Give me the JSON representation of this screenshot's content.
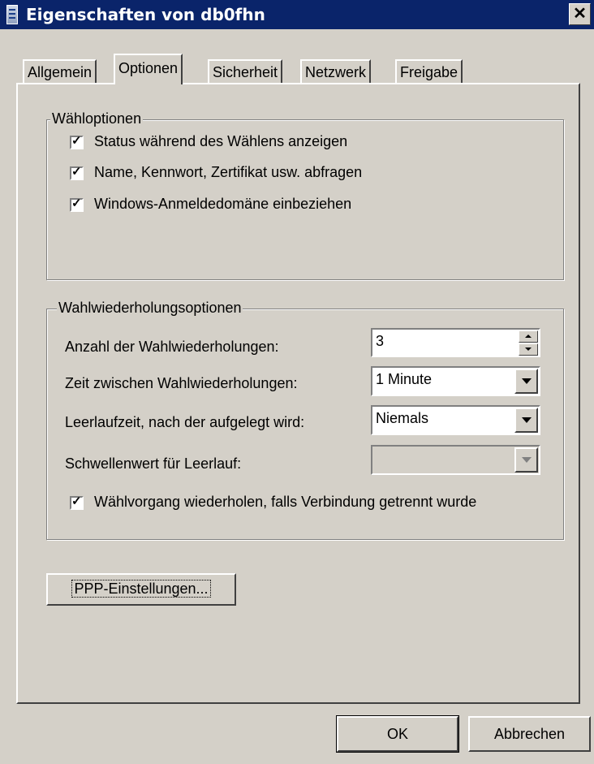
{
  "window": {
    "title": "Eigenschaften von db0fhn",
    "close_glyph": "✕"
  },
  "tabs": [
    {
      "label": "Allgemein",
      "active": false
    },
    {
      "label": "Optionen",
      "active": true
    },
    {
      "label": "Sicherheit",
      "active": false
    },
    {
      "label": "Netzwerk",
      "active": false
    },
    {
      "label": "Freigabe",
      "active": false
    }
  ],
  "dial_options": {
    "legend": "Wähloptionen",
    "items": [
      {
        "label": "Status während des Wählens anzeigen",
        "checked": true
      },
      {
        "label": "Name, Kennwort, Zertifikat usw. abfragen",
        "checked": true
      },
      {
        "label": "Windows-Anmeldedomäne einbeziehen",
        "checked": true
      }
    ]
  },
  "redial_options": {
    "legend": "Wahlwiederholungsoptionen",
    "redial_count_label": "Anzahl der Wahlwiederholungen:",
    "redial_count_value": "3",
    "redial_interval_label": "Zeit zwischen Wahlwiederholungen:",
    "redial_interval_value": "1 Minute",
    "idle_hangup_label": "Leerlaufzeit, nach der aufgelegt wird:",
    "idle_hangup_value": "Niemals",
    "idle_threshold_label": "Schwellenwert für Leerlauf:",
    "idle_threshold_value": "",
    "redial_on_drop_label": "Wählvorgang wiederholen, falls Verbindung getrennt wurde",
    "redial_on_drop_checked": true
  },
  "ppp_button_label": "PPP-Einstellungen...",
  "footer": {
    "ok_label": "OK",
    "cancel_label": "Abbrechen"
  },
  "colors": {
    "face": "#d4d0c8",
    "titlebar": "#0a246a",
    "disabled_text": "#808080"
  }
}
